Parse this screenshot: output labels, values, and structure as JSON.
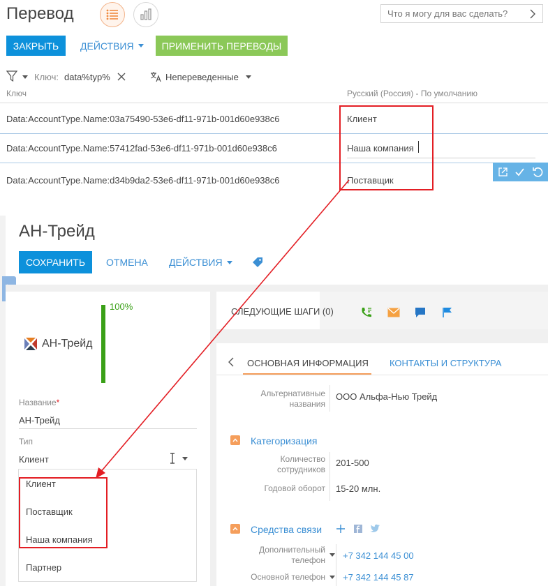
{
  "translation": {
    "title": "Перевод",
    "search_placeholder": "Что я могу для вас сделать?",
    "buttons": {
      "close": "Закрыть",
      "actions": "Действия",
      "apply": "Применить переводы"
    },
    "filter": {
      "key_label": "Ключ:",
      "key_value": "data%typ%",
      "status": "Непереведенные"
    },
    "columns": {
      "key": "Ключ",
      "value": "Русский (Россия) - По умолчанию"
    },
    "rows": [
      {
        "key": "Data:AccountType.Name:03a75490-53e6-df11-971b-001d60e938c6",
        "value": "Клиент"
      },
      {
        "key": "Data:AccountType.Name:57412fad-53e6-df11-971b-001d60e938c6",
        "value": "Наша компания"
      },
      {
        "key": "Data:AccountType.Name:d34b9da2-53e6-df11-971b-001d60e938c6",
        "value": "Поставщик"
      }
    ]
  },
  "account": {
    "title": "АН-Трейд",
    "buttons": {
      "save": "Сохранить",
      "cancel": "Отмена",
      "actions": "Действия"
    },
    "logo_text": "АН-Трейд",
    "completeness": "100%",
    "completeness_fraction": 1.0,
    "name_label": "Название",
    "required_mark": "*",
    "name_value": "АН-Трейд",
    "type_label": "Тип",
    "type_value": "Клиент",
    "type_options": [
      "Клиент",
      "Поставщик",
      "Наша компания",
      "Партнер"
    ],
    "next_steps": "Следующие шаги (0)",
    "tabs": {
      "main": "Основная информация",
      "contacts": "Контакты и структура"
    },
    "alt_names_label": "Альтернативные названия",
    "alt_names_value": "ООО Альфа-Нью Трейд",
    "categorization": "Категоризация",
    "employees_label": "Количество сотрудников",
    "employees_value": "201-500",
    "revenue_label": "Годовой оборот",
    "revenue_value": "15-20 млн.",
    "communications": "Средства связи",
    "extra_phone_label": "Дополнительный телефон",
    "extra_phone_value": "+7 342 144 45 00",
    "main_phone_label": "Основной телефон",
    "main_phone_value": "+7 342 144 45 87"
  },
  "colors": {
    "primary": "#0d91db",
    "apply_green": "#8bc858",
    "link_blue": "#3b8fd4",
    "highlight_red": "#e31e24",
    "section_orange": "#f59e5b",
    "progress_green": "#3aa017"
  }
}
